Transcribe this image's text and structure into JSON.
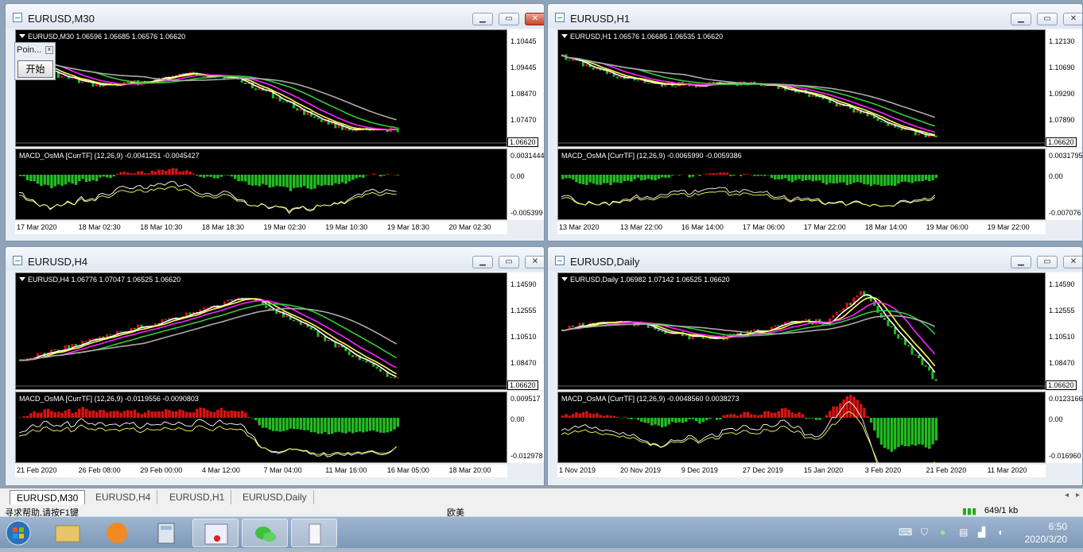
{
  "windows": [
    {
      "id": "m30",
      "title": "EURUSD,M30",
      "header": "EURUSD,M30  1.06596 1.06685 1.06576 1.06620",
      "price_labels": [
        "1.10445",
        "1.09445",
        "1.08470",
        "1.07470"
      ],
      "last_price": "1.06620",
      "macd_header": "MACD_OsMA [CurrTF] (12,26,9) -0.0041251 -0.0045427",
      "macd_labels": [
        "0.0031444",
        "0.00",
        "-0.005399"
      ],
      "time_labels": [
        "17 Mar 2020",
        "18 Mar 02:30",
        "18 Mar 10:30",
        "18 Mar 18:30",
        "19 Mar 02:30",
        "19 Mar 10:30",
        "19 Mar 18:30",
        "20 Mar 02:30"
      ]
    },
    {
      "id": "h1",
      "title": "EURUSD,H1",
      "header": "EURUSD,H1  1.06576 1.06685 1.06535 1.06620",
      "price_labels": [
        "1.12130",
        "1.10690",
        "1.09290",
        "1.07890"
      ],
      "last_price": "1.06620",
      "macd_header": "MACD_OsMA [CurrTF] (12,26,9) -0.0065990 -0.0059386",
      "macd_labels": [
        "0.0031795",
        "0.00",
        "-0.007076"
      ],
      "time_labels": [
        "13 Mar 2020",
        "13 Mar 22:00",
        "16 Mar 14:00",
        "17 Mar 06:00",
        "17 Mar 22:00",
        "18 Mar 14:00",
        "19 Mar 06:00",
        "19 Mar 22:00"
      ]
    },
    {
      "id": "h4",
      "title": "EURUSD,H4",
      "header": "EURUSD,H4  1.06776 1.07047 1.06525 1.06620",
      "price_labels": [
        "1.14590",
        "1.12555",
        "1.10510",
        "1.08470"
      ],
      "last_price": "1.06620",
      "macd_header": "MACD_OsMA [CurrTF] (12,26,9) -0.0119556 -0.0090803",
      "macd_labels": [
        "0.009517",
        "0.00",
        "-0.012978"
      ],
      "time_labels": [
        "21 Feb 2020",
        "26 Feb 08:00",
        "29 Feb 00:00",
        "4 Mar 12:00",
        "7 Mar 04:00",
        "11 Mar 16:00",
        "16 Mar 05:00",
        "18 Mar 20:00"
      ]
    },
    {
      "id": "d1",
      "title": "EURUSD,Daily",
      "header": "EURUSD,Daily  1.06982 1.07142 1.06525 1.06620",
      "price_labels": [
        "1.14590",
        "1.12555",
        "1.10510",
        "1.08470"
      ],
      "last_price": "1.06620",
      "macd_header": "MACD_OsMA [CurrTF] (12,26,9) -0.0048560 0.0038273",
      "macd_labels": [
        "0.0123166",
        "0.00",
        "-0.016960"
      ],
      "time_labels": [
        "1 Nov 2019",
        "20 Nov 2019",
        "9 Dec 2019",
        "27 Dec 2019",
        "15 Jan 2020",
        "3 Feb 2020",
        "21 Feb 2020",
        "11 Mar 2020"
      ]
    }
  ],
  "point_window": {
    "title": "Poin...",
    "button": "开始"
  },
  "tabs": [
    "EURUSD,M30",
    "EURUSD,H4",
    "EURUSD,H1",
    "EURUSD,Daily"
  ],
  "status": {
    "help": "寻求帮助,请按F1键",
    "profile": "欧美",
    "traffic": "649/1 kb"
  },
  "clock": {
    "time": "6:50",
    "date": "2020/3/20"
  },
  "colors": {
    "bull": "#22bb22",
    "bear": "#dd1111",
    "ma_white": "#ffffff",
    "ma_yellow": "#ffff55",
    "ma_magenta": "#ff22ff",
    "ma_green": "#33cc33",
    "ma_gray": "#aaaaaa"
  }
}
